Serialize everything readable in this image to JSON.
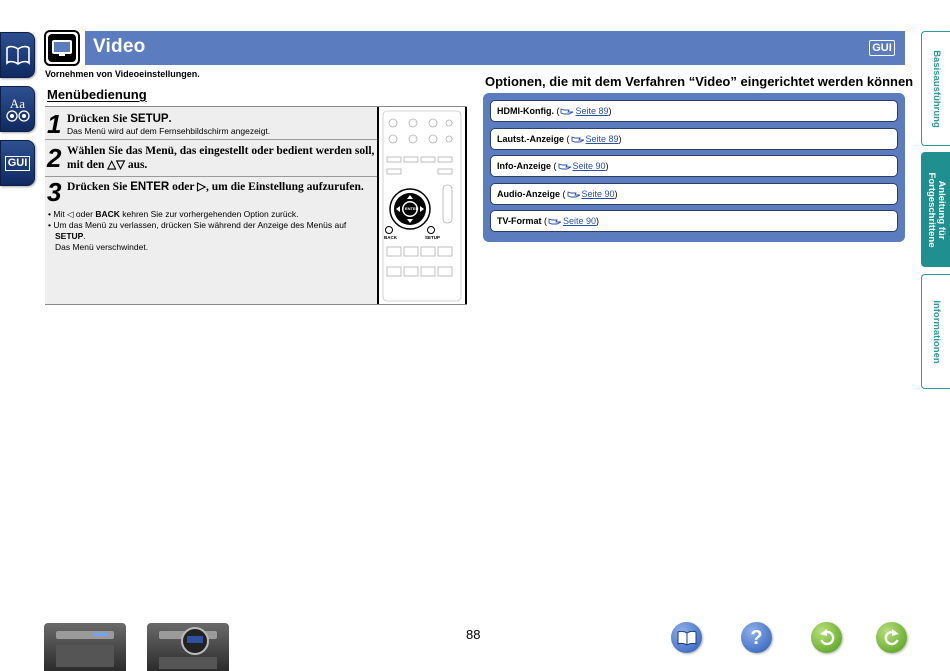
{
  "header": {
    "title": "Video",
    "gui_badge": "GUI"
  },
  "subtitle": "Vornehmen von Videoeinstellungen.",
  "menu_heading": "Menübedienung",
  "steps": [
    {
      "number": "1",
      "text_prefix": "Drücken Sie ",
      "key": "SETUP",
      "text_suffix": ".",
      "sub": "Das Menü wird auf dem Fernsehbildschirm angezeigt."
    },
    {
      "number": "2",
      "text": "Wählen Sie das Menü, das eingestellt oder bedient werden soll, mit den △▽ aus."
    },
    {
      "number": "3",
      "text_prefix": "Drücken Sie ",
      "key": "ENTER",
      "text_suffix": " oder ▷, um die Einstellung aufzurufen."
    }
  ],
  "notes": {
    "note1_prefix": "Mit ◁ oder ",
    "note1_key": "BACK",
    "note1_suffix": " kehren Sie zur vorhergehenden Option zurück.",
    "note2_text": "Um das Menü zu verlassen, drücken Sie während der Anzeige des Menüs auf",
    "note2_key": "SETUP",
    "note2_end": ".",
    "note3": "Das Menü verschwindet."
  },
  "remote": {
    "enter_label": "ENTER",
    "back_label": "BACK",
    "setup_label": "SETUP"
  },
  "options_heading": "Optionen, die mit dem Verfahren “Video” eingerichtet werden können",
  "options": [
    {
      "name": "HDMI-Konfig.",
      "ref": "Seite 89"
    },
    {
      "name": "Lautst.-Anzeige",
      "ref": "Seite 89"
    },
    {
      "name": "Info-Anzeige",
      "ref": "Seite 90"
    },
    {
      "name": "Audio-Anzeige",
      "ref": "Seite 90"
    },
    {
      "name": "TV-Format",
      "ref": "Seite 90"
    }
  ],
  "right_tabs": [
    {
      "label": "Basisausführung"
    },
    {
      "label_line1": "Anleitung für",
      "label_line2": "Fortgeschrittene"
    },
    {
      "label": "Informationen"
    }
  ],
  "left_icons": {
    "aa_label": "Aa",
    "gui_label": "GUI"
  },
  "page_number": "88",
  "colors": {
    "header_blue": "#5c7cc0",
    "tab_teal": "#1f8f8f",
    "link_blue": "#2a4fa8",
    "panel_gray": "#eeeeee"
  }
}
